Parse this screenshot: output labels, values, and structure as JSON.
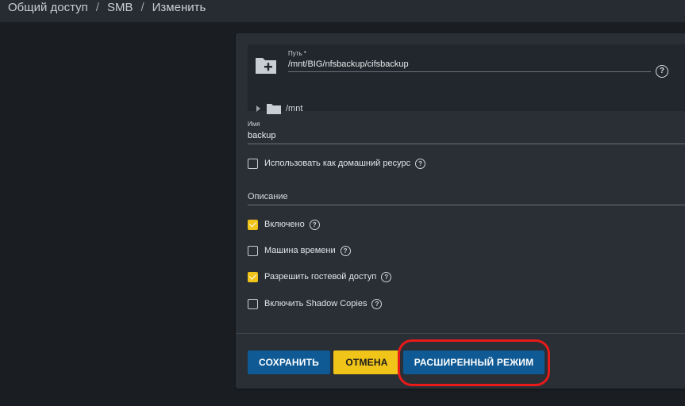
{
  "breadcrumb": {
    "items": [
      "Общий доступ",
      "SMB",
      "Изменить"
    ],
    "separator": "/"
  },
  "explorer": {
    "path_label": "Путь *",
    "path_value": "/mnt/BIG/nfsbackup/cifsbackup",
    "help_icon": "?",
    "tree_root": "/mnt"
  },
  "form": {
    "name_label": "Имя",
    "name_value": "backup",
    "home_share_label": "Использовать как домашний ресурс",
    "home_share_checked": false,
    "description_label": "Описание",
    "enabled_label": "Включено",
    "enabled_checked": true,
    "time_machine_label": "Машина времени",
    "time_machine_checked": false,
    "guest_access_label": "Разрешить гостевой доступ",
    "guest_access_checked": true,
    "shadow_copies_label": "Включить Shadow Copies",
    "shadow_copies_checked": false,
    "help_icon": "?"
  },
  "buttons": {
    "save": "СОХРАНИТЬ",
    "cancel": "ОТМЕНА",
    "advanced": "РАСШИРЕННЫЙ РЕЖИМ"
  },
  "colors": {
    "background": "#1a1e23",
    "card": "#2a2f35",
    "primary": "#0f5a94",
    "accent": "#f0c419",
    "highlight": "#e81a1a"
  },
  "icons": {
    "folder_add": "folder-plus-icon",
    "tree_folder": "folder-icon",
    "tree_arrow": "caret-right-icon",
    "help": "help-circle-icon"
  }
}
